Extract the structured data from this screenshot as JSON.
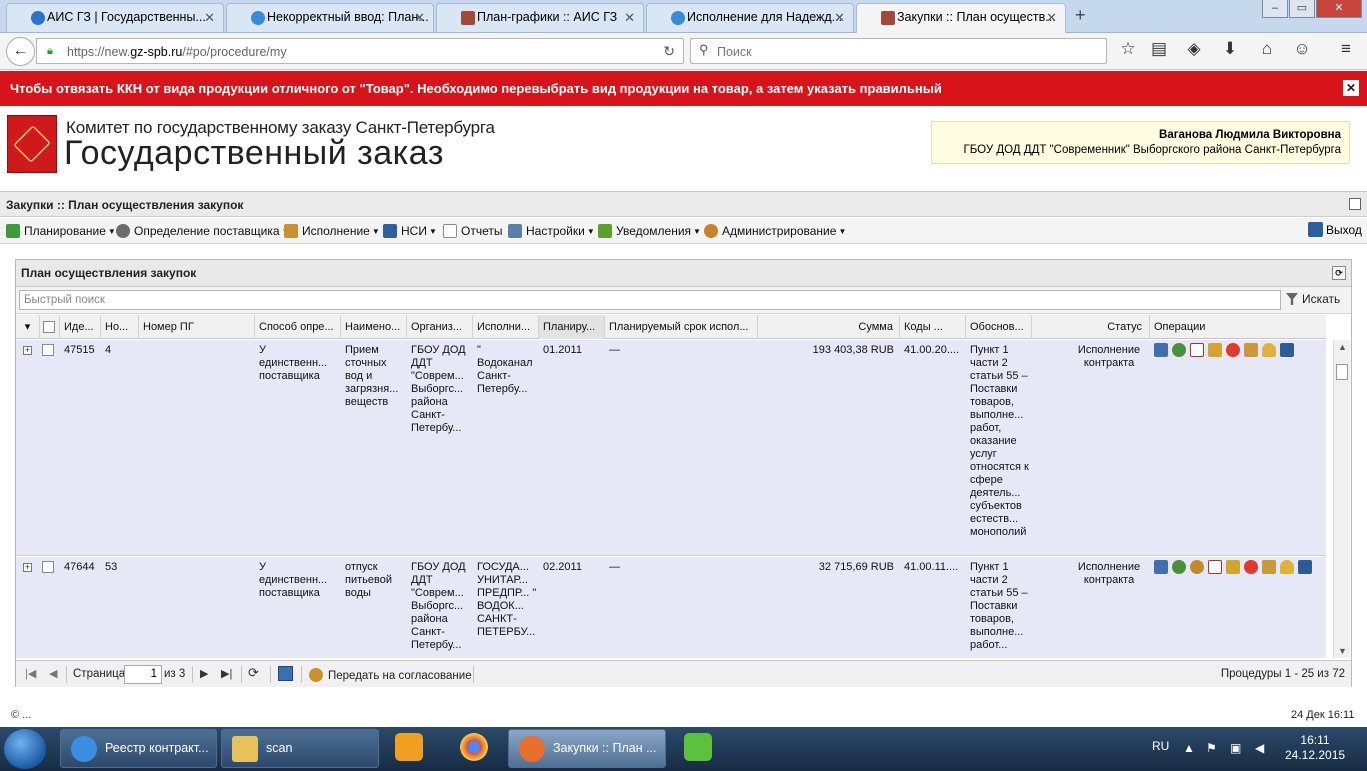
{
  "browser": {
    "tabs": [
      {
        "label": "АИС ГЗ | Государственны...",
        "icon": "ais-logo-icon",
        "active": false
      },
      {
        "label": "Некорректный ввод: План...",
        "icon": "help-globe-icon",
        "active": false
      },
      {
        "label": "План-графики :: АИС ГЗ",
        "icon": "hammer-icon",
        "active": false
      },
      {
        "label": "Исполнение для Надежд...",
        "icon": "help-globe-icon",
        "active": false
      },
      {
        "label": "Закупки :: План осуществ...",
        "icon": "hammer-icon",
        "active": true
      }
    ],
    "close_glyph": "✕",
    "new_tab_glyph": "+",
    "url_prefix": "https://new.",
    "url_host": "gz-spb.ru",
    "url_path": "/#po/procedure/my",
    "search_placeholder": "Поиск"
  },
  "banner": {
    "text": "Чтобы отвязать ККН от вида продукции отличного от \"Товар\". Необходимо перевыбрать вид продукции на товар, а затем указать правильный",
    "close_glyph": "✕"
  },
  "header": {
    "org_line1": "Комитет по государственному заказу Санкт-Петербурга",
    "org_line2": "Государственный заказ",
    "user_name": "Ваганова Людмила Викторовна",
    "user_org": "ГБОУ ДОД ДДТ \"Современник\" Выборгского района Санкт-Петербурга"
  },
  "app": {
    "title": "Закупки :: План осуществления закупок",
    "menu": [
      {
        "label": "Планирование",
        "icon": "planning-icon",
        "color": "#3d9a3d",
        "dropdown": true
      },
      {
        "label": "Определение поставщика",
        "icon": "gear-icon",
        "color": "#6b6b6b",
        "dropdown": true
      },
      {
        "label": "Исполнение",
        "icon": "execution-icon",
        "color": "#c7912d",
        "dropdown": true
      },
      {
        "label": "НСИ",
        "icon": "book-icon",
        "color": "#2f5f9e",
        "dropdown": true
      },
      {
        "label": "Отчеты",
        "icon": "report-icon",
        "color": "#8b8b8b",
        "dropdown": false
      },
      {
        "label": "Настройки",
        "icon": "wrench-icon",
        "color": "#5a7fa8",
        "dropdown": true
      },
      {
        "label": "Уведомления",
        "icon": "notification-icon",
        "color": "#5aa12f",
        "dropdown": true
      },
      {
        "label": "Администрирование",
        "icon": "user-icon",
        "color": "#c9822b",
        "dropdown": true
      }
    ],
    "exit_label": "Выход"
  },
  "grid": {
    "title": "План осуществления закупок",
    "quick_search_placeholder": "Быстрый поиск",
    "search_button": "Искать",
    "columns": [
      {
        "label": "Иде..."
      },
      {
        "label": "Но..."
      },
      {
        "label": "Номер ПГ"
      },
      {
        "label": "Способ опре..."
      },
      {
        "label": "Наимено..."
      },
      {
        "label": "Организ..."
      },
      {
        "label": "Исполни..."
      },
      {
        "label": "Планиру..."
      },
      {
        "label": "Планируемый срок испол..."
      },
      {
        "label": "Сумма"
      },
      {
        "label": "Коды ..."
      },
      {
        "label": "Обоснов..."
      },
      {
        "label": "Статус"
      },
      {
        "label": "Операции"
      }
    ],
    "rows": [
      {
        "id": "47515",
        "num": "4",
        "pg": "",
        "method": "У единственн... поставщика",
        "name": "Прием сточных вод и загрязня... веществ",
        "org": "ГБОУ ДОД ДДТ \"Соврем... Выборгс... района Санкт-Петербу...",
        "executor": "\" Водоканал Санкт-Петербу...",
        "plan_month": "01.2011",
        "plan_term": "—",
        "sum": "193 403,38 RUB",
        "codes": "41.00.20....",
        "basis": "Пункт 1 части 2 статьи 55 – Поставки товаров, выполне... работ, оказание услуг относятся к сфере деятель... субъектов естеств... монополий",
        "status": "Исполнение контракта"
      },
      {
        "id": "47644",
        "num": "53",
        "pg": "",
        "method": "У единственн... поставщика",
        "name": "отпуск питьевой воды",
        "org": "ГБОУ ДОД ДДТ \"Соврем... Выборгс... района Санкт-Петербу...",
        "executor": "ГОСУДА... УНИТАР... ПРЕДПР... \" ВОДОК... САНКТ-ПЕТЕРБУ...",
        "plan_month": "02.2011",
        "plan_term": "—",
        "sum": "32 715,69 RUB",
        "codes": "41.00.11....",
        "basis": "Пункт 1 части 2 статьи 55 – Поставки товаров, выполне... работ...",
        "status": "Исполнение контракта"
      }
    ],
    "pager": {
      "page_label": "Страница",
      "page_value": "1",
      "of_label": "из 3",
      "submit_label": "Передать на согласование",
      "summary": "Процедуры 1 - 25 из 72"
    }
  },
  "statusbar": {
    "left": "© ...",
    "right": "24 Дек 16:11"
  },
  "taskbar": {
    "items": [
      {
        "label": "Реестр контракт...",
        "icon": "ie-icon",
        "color": "#3b8fe0"
      },
      {
        "label": "scan",
        "icon": "folder-icon",
        "color": "#e7c25a"
      },
      {
        "label": "Закупки :: План ...",
        "icon": "firefox-icon",
        "color": "#e8702a"
      }
    ],
    "lang": "RU",
    "time": "16:11",
    "date": "24.12.2015"
  }
}
